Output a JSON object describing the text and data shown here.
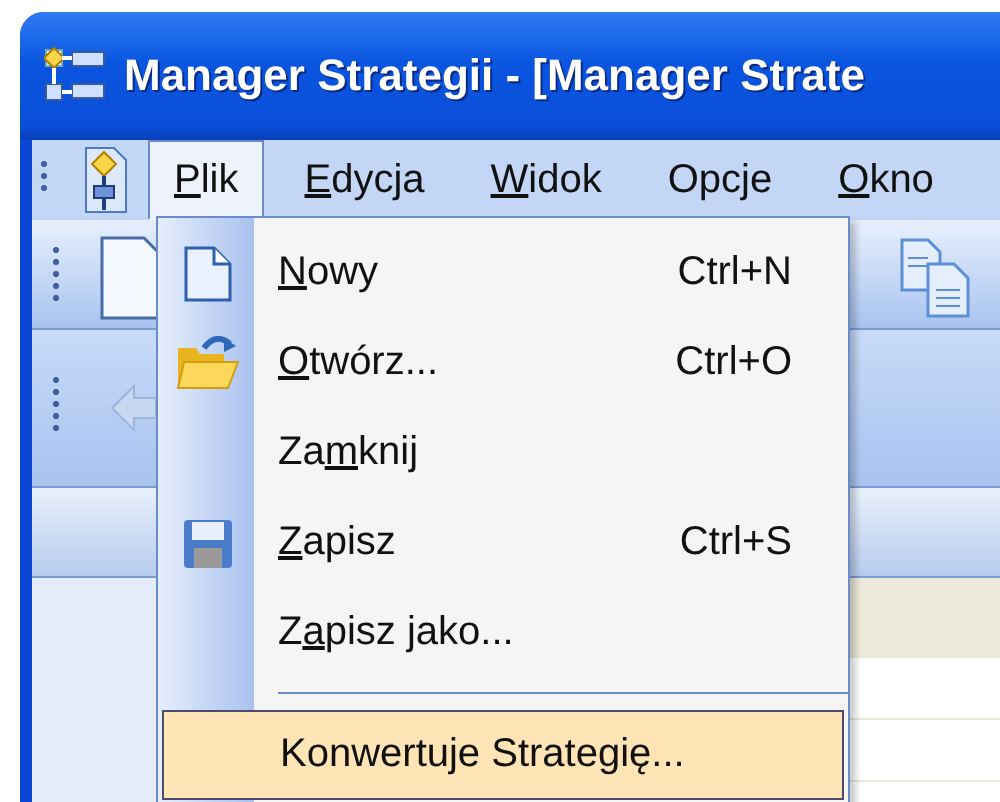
{
  "window": {
    "title": "Manager Strategii - [Manager Strate"
  },
  "menubar": [
    {
      "label": [
        {
          "text": "P",
          "underlined": true
        },
        {
          "text": "lik",
          "underlined": false
        }
      ],
      "selected": true
    },
    {
      "label": [
        {
          "text": "E",
          "underlined": true
        },
        {
          "text": "dycja",
          "underlined": false
        }
      ],
      "selected": false
    },
    {
      "label": [
        {
          "text": "W",
          "underlined": true
        },
        {
          "text": "idok",
          "underlined": false
        }
      ],
      "selected": false
    },
    {
      "label": [
        {
          "text": "Opcje",
          "underlined": false
        }
      ],
      "selected": false
    },
    {
      "label": [
        {
          "text": "O",
          "underlined": true
        },
        {
          "text": "kno",
          "underlined": false
        }
      ],
      "selected": false
    }
  ],
  "menu": {
    "items": [
      {
        "kind": "item",
        "label": [
          {
            "text": "N",
            "underlined": true
          },
          {
            "text": "owy",
            "underlined": false
          }
        ],
        "shortcut": "Ctrl+N",
        "highlighted": false
      },
      {
        "kind": "item",
        "label": [
          {
            "text": "O",
            "underlined": true
          },
          {
            "text": "twórz...",
            "underlined": false
          }
        ],
        "shortcut": "Ctrl+O",
        "highlighted": false
      },
      {
        "kind": "item",
        "label": [
          {
            "text": "Za",
            "underlined": false
          },
          {
            "text": "m",
            "underlined": true
          },
          {
            "text": "knij",
            "underlined": false
          }
        ],
        "highlighted": false
      },
      {
        "kind": "item",
        "label": [
          {
            "text": "Z",
            "underlined": true
          },
          {
            "text": "apisz",
            "underlined": false
          }
        ],
        "shortcut": "Ctrl+S",
        "highlighted": false
      },
      {
        "kind": "item",
        "label": [
          {
            "text": "Z",
            "underlined": false
          },
          {
            "text": "a",
            "underlined": true
          },
          {
            "text": "pisz jako...",
            "underlined": false
          }
        ],
        "highlighted": false
      },
      {
        "kind": "separator"
      },
      {
        "kind": "item",
        "label": [
          {
            "text": "Konwertuje Strategię...",
            "underlined": false
          }
        ],
        "highlighted": true
      }
    ]
  }
}
